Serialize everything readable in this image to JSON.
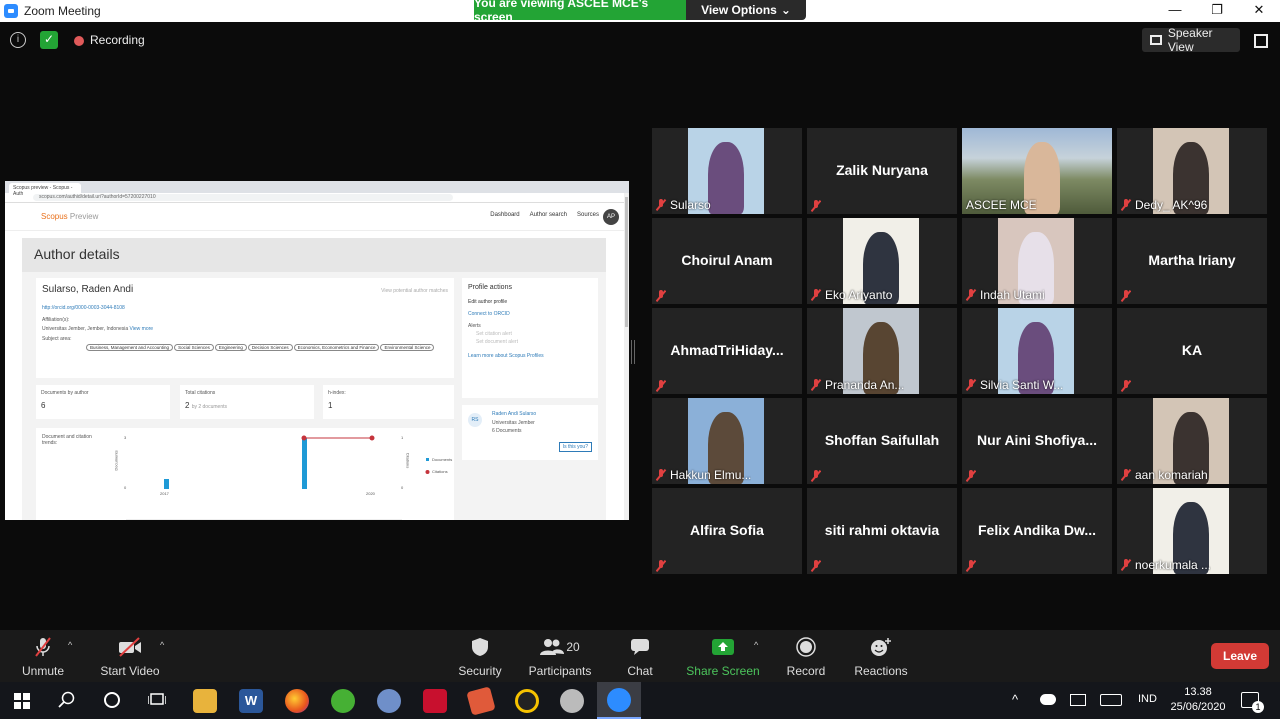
{
  "window": {
    "title": "Zoom Meeting",
    "minimize": "—",
    "restore": "❐",
    "close": "✕"
  },
  "banner": {
    "viewing": "You are viewing ASCEE MCE's screen",
    "view_options": "View Options",
    "chevron": "⌄"
  },
  "meeting_bar": {
    "recording_label": "Recording",
    "speaker_view_label": "Speaker View",
    "info_icon": "i"
  },
  "shared_screen": {
    "browser_tab_title": "Scopus preview - Scopus - Auth",
    "url": "scopus.com/authid/detail.uri?authorId=57200227010",
    "logo": "Scopus",
    "logo_suffix": "Preview",
    "nav": [
      "Dashboard",
      "Author search",
      "Sources"
    ],
    "avatar": "AP",
    "page_title": "Author details",
    "author_name": "Sularso, Raden Andi",
    "view_potential": "View potential author matches",
    "orcid": "http://orcid.org/0000-0003-3044-8108",
    "affiliation_label": "Affiliation(s):",
    "affiliation": "Universitas Jember, Jember, Indonesia",
    "view_more": "View more",
    "subject_label": "Subject area:",
    "subjects": [
      "Business, Management and Accounting",
      "Social Sciences",
      "Engineering",
      "Decision Sciences",
      "Economics, Econometrics and Finance",
      "Environmental Science"
    ],
    "metrics": [
      {
        "label": "Documents by author",
        "value": "6"
      },
      {
        "label": "Total citations",
        "value": "2",
        "suffix": "by 2 documents"
      },
      {
        "label": "h-index:",
        "value": "1"
      }
    ],
    "profile_actions": {
      "title": "Profile actions",
      "edit": "Edit author profile",
      "orcid": "Connect to ORCID",
      "alerts": "Alerts",
      "citation_alert": "Set citation alert",
      "document_alert": "Set document alert",
      "learn": "Learn more about Scopus Profiles"
    },
    "author_card": {
      "initials": "RS",
      "name": "Raden Andi Sularso",
      "affiliation": "Universitas Jember",
      "docs": "6 Documents",
      "is_you": "Is this you?"
    },
    "trend": {
      "title": "Document and citation trends:",
      "left_axis": "Documents",
      "right_axis": "Citations",
      "left_ticks": [
        "3",
        "0"
      ],
      "right_ticks": [
        "1",
        "0"
      ],
      "x_labels": [
        "2017",
        "2020"
      ],
      "legend_documents": "Documents",
      "legend_citations": "Citations"
    }
  },
  "participants": [
    {
      "name": "Sularso",
      "video": true
    },
    {
      "name": "Zalik Nuryana",
      "video": false
    },
    {
      "name": "ASCEE MCE",
      "video": true,
      "active": true
    },
    {
      "name": "Dedy_ AK^96",
      "video": true
    },
    {
      "name": "Choirul Anam",
      "video": false
    },
    {
      "name": "Eko Ariyanto",
      "video": true
    },
    {
      "name": "Indah Utami",
      "video": true
    },
    {
      "name": "Martha Iriany",
      "video": false
    },
    {
      "name": "AhmadTriHiday...",
      "video": false
    },
    {
      "name": "Prananda An...",
      "video": true
    },
    {
      "name": "Silvia Santi W...",
      "video": true
    },
    {
      "name": "KA",
      "video": false
    },
    {
      "name": "Hakkun Elmu...",
      "video": true
    },
    {
      "name": "Shoffan Saifullah",
      "video": false
    },
    {
      "name": "Nur Aini Shofiya...",
      "video": false
    },
    {
      "name": "aan komariah",
      "video": true
    },
    {
      "name": "Alfira Sofia",
      "video": false
    },
    {
      "name": "siti rahmi oktavia",
      "video": false
    },
    {
      "name": "Felix Andika Dw...",
      "video": false
    },
    {
      "name": "noerkumala ...",
      "video": true
    }
  ],
  "toolbar": {
    "unmute": "Unmute",
    "start_video": "Start Video",
    "security": "Security",
    "participants": "Participants",
    "participants_count": "20",
    "chat": "Chat",
    "share_screen": "Share Screen",
    "record": "Record",
    "reactions": "Reactions",
    "leave": "Leave",
    "caret": "^"
  },
  "taskbar": {
    "time": "13.38",
    "date": "25/06/2020",
    "lang": "IND",
    "notification_count": "1"
  },
  "colors": {
    "active_speaker": "#e8e75b",
    "share_green": "#23a435",
    "leave_red": "#d23a35",
    "mute_red": "#e04040"
  }
}
